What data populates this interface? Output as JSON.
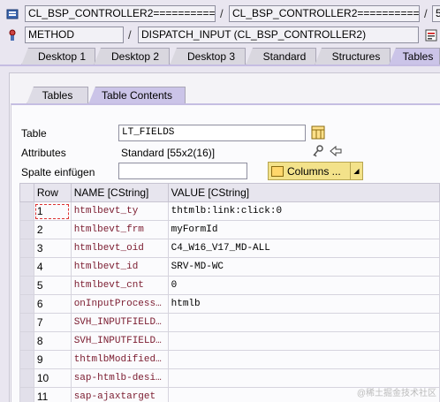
{
  "breadcrumb": {
    "class_field": "CL_BSP_CONTROLLER2===========...",
    "class_field2": "CL_BSP_CONTROLLER2===========...",
    "slash1": "/",
    "slash2": "/",
    "trail": "5",
    "method_label": "METHOD",
    "method_value": "DISPATCH_INPUT (CL_BSP_CONTROLLER2)"
  },
  "desktop_tabs": [
    "Desktop 1",
    "Desktop 2",
    "Desktop 3",
    "Standard",
    "Structures",
    "Tables"
  ],
  "sub_tabs": [
    "Tables",
    "Table Contents"
  ],
  "form": {
    "table_label": "Table",
    "table_value": "LT_FIELDS",
    "attributes_label": "Attributes",
    "attributes_value": "Standard [55x2(16)]",
    "insert_label": "Spalte einfügen",
    "insert_value": "",
    "columns_button": "Columns ..."
  },
  "grid": {
    "headers": [
      "Row",
      "NAME [CString]",
      "VALUE [CString]"
    ],
    "rows": [
      {
        "row": "1",
        "name": "htmlbevt_ty",
        "value": "thtmlb:link:click:0"
      },
      {
        "row": "2",
        "name": "htmlbevt_frm",
        "value": "myFormId"
      },
      {
        "row": "3",
        "name": "htmlbevt_oid",
        "value": "C4_W16_V17_MD-ALL"
      },
      {
        "row": "4",
        "name": "htmlbevt_id",
        "value": "SRV-MD-WC"
      },
      {
        "row": "5",
        "name": "htmlbevt_cnt",
        "value": "0"
      },
      {
        "row": "6",
        "name": "onInputProcess…",
        "value": "htmlb"
      },
      {
        "row": "7",
        "name": "SVH_INPUTFIELD…",
        "value": ""
      },
      {
        "row": "8",
        "name": "SVH_INPUTFIELD…",
        "value": ""
      },
      {
        "row": "9",
        "name": "thtmlbModified…",
        "value": ""
      },
      {
        "row": "10",
        "name": "sap-htmlb-desi…",
        "value": ""
      },
      {
        "row": "11",
        "name": "sap-ajaxtarget",
        "value": ""
      }
    ]
  },
  "watermark": "@稀土掘金技术社区"
}
